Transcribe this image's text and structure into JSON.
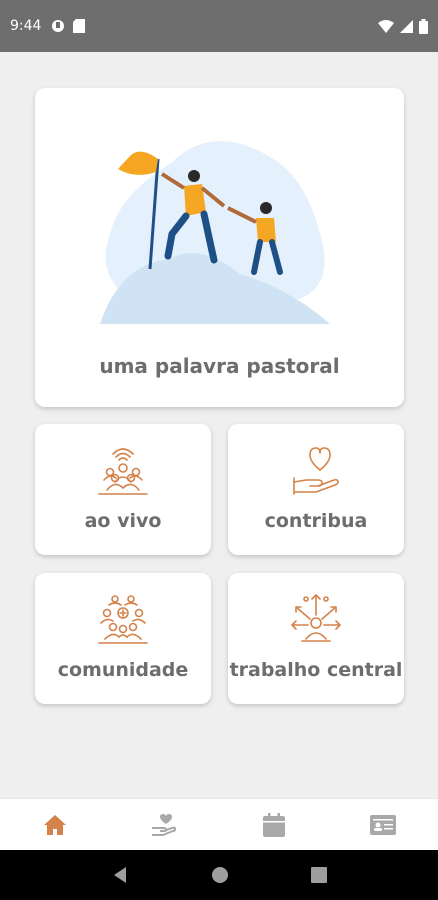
{
  "status_bar": {
    "time": "9:44",
    "left_icons": [
      "data-saver-icon",
      "sd-card-icon"
    ],
    "right_icons": [
      "wifi-icon",
      "signal-icon",
      "battery-icon"
    ]
  },
  "hero_card": {
    "label": "uma palavra pastoral",
    "illustration": "climbing-help-illustration"
  },
  "menu_cards": [
    {
      "label": "ao vivo",
      "icon": "live-audience-icon"
    },
    {
      "label": "contribua",
      "icon": "heart-hand-icon"
    },
    {
      "label": "comunidade",
      "icon": "community-icon"
    },
    {
      "label": "trabalho central",
      "icon": "outreach-icon"
    }
  ],
  "bottom_nav": [
    {
      "icon": "home-icon",
      "active": true
    },
    {
      "icon": "hand-heart-icon",
      "active": false
    },
    {
      "icon": "calendar-icon",
      "active": false
    },
    {
      "icon": "id-card-icon",
      "active": false
    }
  ],
  "colors": {
    "accent": "#d4824a",
    "label_gray": "#6d6d6d",
    "nav_gray": "#a8a8a8",
    "illustration_orange": "#f5a623",
    "illustration_blue": "#1e4f86"
  }
}
